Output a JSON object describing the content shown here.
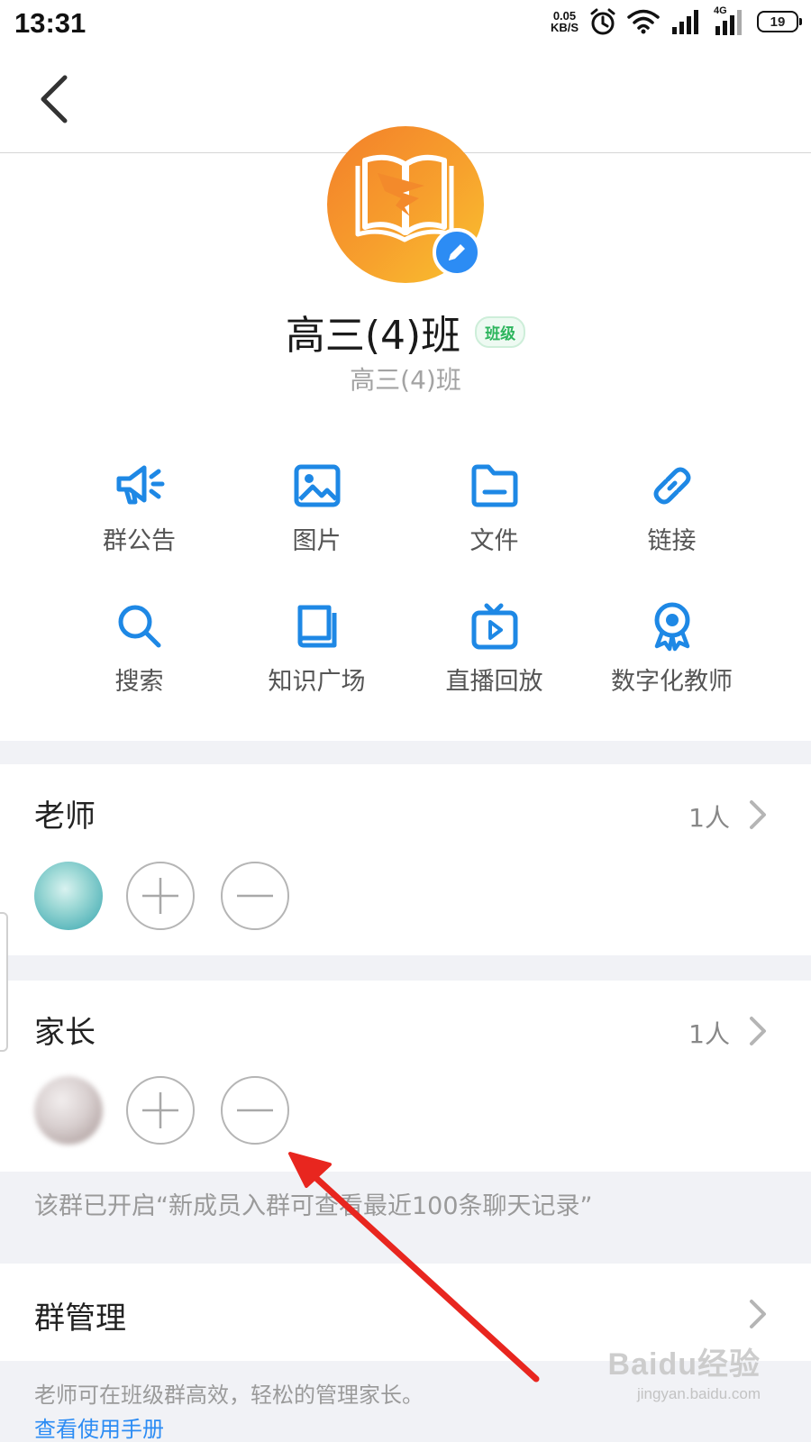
{
  "status_bar": {
    "time": "13:31",
    "net_speed_value": "0.05",
    "net_speed_unit": "KB/S",
    "network_type": "4G",
    "battery": "19",
    "icons": [
      "alarm-icon",
      "wifi-icon",
      "signal-icon",
      "signal-4g-icon",
      "battery-icon"
    ]
  },
  "group": {
    "name": "高三(4)班",
    "badge": "班级",
    "subtitle": "高三(4)班"
  },
  "actions": [
    {
      "label": "群公告",
      "icon": "megaphone-icon"
    },
    {
      "label": "图片",
      "icon": "image-icon"
    },
    {
      "label": "文件",
      "icon": "folder-icon"
    },
    {
      "label": "链接",
      "icon": "link-icon"
    },
    {
      "label": "搜索",
      "icon": "search-icon"
    },
    {
      "label": "知识广场",
      "icon": "book-icon"
    },
    {
      "label": "直播回放",
      "icon": "tv-play-icon"
    },
    {
      "label": "数字化教师",
      "icon": "award-icon"
    }
  ],
  "teachers": {
    "title": "老师",
    "count": "1人"
  },
  "parents": {
    "title": "家长",
    "count": "1人"
  },
  "notice": "该群已开启“新成员入群可查看最近100条聊天记录”",
  "management": {
    "title": "群管理",
    "description": "老师可在班级群高效，轻松的管理家长。",
    "link": "查看使用手册"
  },
  "watermark": {
    "main": "Baidu经验",
    "sub": "jingyan.baidu.com"
  },
  "colors": {
    "accent": "#2c8cf4",
    "icon_blue": "#1e88e5",
    "badge_green": "#2db55d",
    "annotation_red": "#e8261f"
  }
}
